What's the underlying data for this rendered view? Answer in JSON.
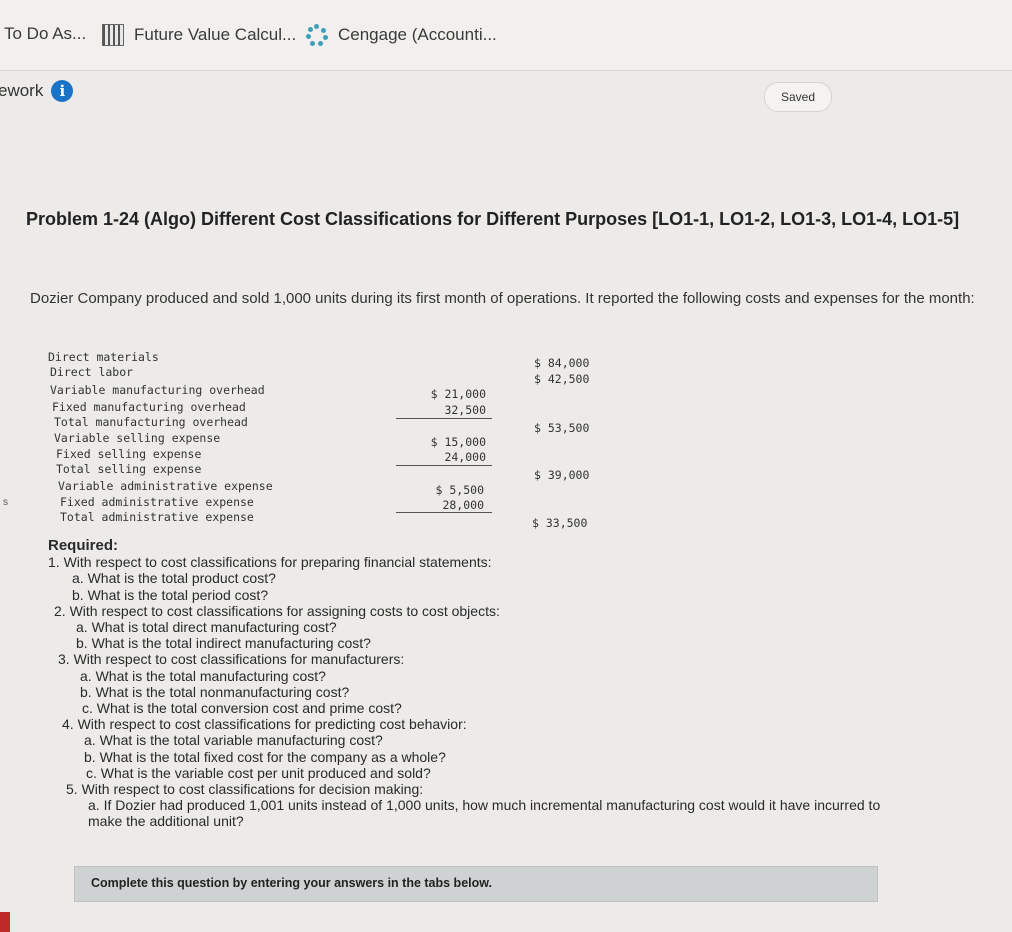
{
  "bookmarks": [
    {
      "label": "To Do As...",
      "icon": "none"
    },
    {
      "label": "Future Value Calcul...",
      "icon": "calculator-icon"
    },
    {
      "label": "Cengage (Accounti...",
      "icon": "spinner-icon"
    }
  ],
  "header": {
    "work_label": "ework",
    "saved_label": "Saved"
  },
  "problem": {
    "title": "Problem 1-24 (Algo) Different Cost Classifications for Different Purposes [LO1-1, LO1-2, LO1-3, LO1-4, LO1-5]",
    "intro": "Dozier Company produced and sold 1,000 units during its first month of operations. It reported the following costs and expenses for the month:"
  },
  "cost_table": {
    "rows": [
      {
        "label": "Direct materials",
        "col1": "",
        "col2": "$ 84,000"
      },
      {
        "label": "Direct labor",
        "col1": "",
        "col2": "$ 42,500"
      },
      {
        "label": "Variable manufacturing overhead",
        "col1": "$ 21,000",
        "col2": ""
      },
      {
        "label": "Fixed manufacturing overhead",
        "col1": "32,500",
        "col2": ""
      },
      {
        "label": "Total manufacturing overhead",
        "col1": "",
        "col2": "$ 53,500"
      },
      {
        "label": "Variable selling expense",
        "col1": "$ 15,000",
        "col2": ""
      },
      {
        "label": "Fixed selling expense",
        "col1": "24,000",
        "col2": ""
      },
      {
        "label": "Total selling expense",
        "col1": "",
        "col2": "$ 39,000"
      },
      {
        "label": "Variable administrative expense",
        "col1": "$ 5,500",
        "col2": ""
      },
      {
        "label": "Fixed administrative expense",
        "col1": "28,000",
        "col2": ""
      },
      {
        "label": "Total administrative expense",
        "col1": "",
        "col2": "$ 33,500"
      }
    ]
  },
  "required": {
    "heading": "Required:",
    "lines": [
      "1. With respect to cost classifications for preparing financial statements:",
      "a. What is the total product cost?",
      "b. What is the total period cost?",
      "2. With respect to cost classifications for assigning costs to cost objects:",
      "a. What is total direct manufacturing cost?",
      "b. What is the total indirect manufacturing cost?",
      "3. With respect to cost classifications for manufacturers:",
      "a. What is the total manufacturing cost?",
      "b. What is the total nonmanufacturing cost?",
      "c. What is the total conversion cost and prime cost?",
      "4. With respect to cost classifications for predicting cost behavior:",
      "a. What is the total variable manufacturing cost?",
      "b. What is the total fixed cost for the company as a whole?",
      "c. What is the variable cost per unit produced and sold?",
      "5. With respect to cost classifications for decision making:",
      "a. If Dozier had produced 1,001 units instead of 1,000 units, how much incremental manufacturing cost would it have incurred to",
      "make the additional unit?"
    ]
  },
  "footer": {
    "instruction": "Complete this question by entering your answers in the tabs below."
  },
  "side_mark": "s",
  "colors": {
    "info_blue": "#1a73c9",
    "spinner": "#3f9fb8",
    "red_tab": "#c0292a"
  }
}
